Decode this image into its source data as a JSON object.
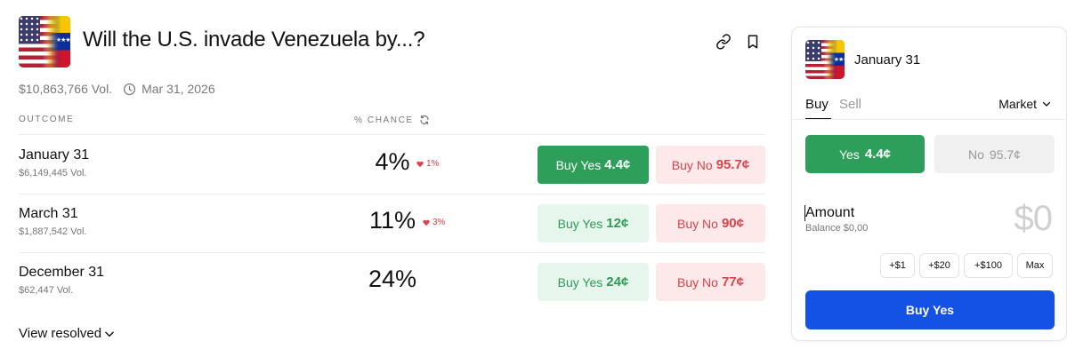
{
  "market": {
    "title": "Will the U.S. invade Venezuela by...?",
    "volume": "$10,863,766 Vol.",
    "end_date": "Mar 31, 2026"
  },
  "columns": {
    "outcome": "OUTCOME",
    "chance": "% CHANCE"
  },
  "rows": [
    {
      "name": "January 31",
      "volume": "$6,149,445 Vol.",
      "chance": "4%",
      "delta": "1%",
      "yes_label": "Buy Yes",
      "yes_price": "4.4¢",
      "no_label": "Buy No",
      "no_price": "95.7¢"
    },
    {
      "name": "March 31",
      "volume": "$1,887,542 Vol.",
      "chance": "11%",
      "delta": "3%",
      "yes_label": "Buy Yes",
      "yes_price": "12¢",
      "no_label": "Buy No",
      "no_price": "90¢"
    },
    {
      "name": "December 31",
      "volume": "$62,447 Vol.",
      "chance": "24%",
      "delta": "",
      "yes_label": "Buy Yes",
      "yes_price": "24¢",
      "no_label": "Buy No",
      "no_price": "77¢"
    }
  ],
  "view_resolved": "View resolved",
  "panel": {
    "title": "January 31",
    "tab_buy": "Buy",
    "tab_sell": "Sell",
    "order_type": "Market",
    "yes_label": "Yes",
    "yes_price": "4.4¢",
    "no_label": "No",
    "no_price": "95.7¢",
    "amount_label": "Amount",
    "balance": "Balance $0,00",
    "amount_value": "$0",
    "quick": [
      "+$1",
      "+$20",
      "+$100",
      "Max"
    ],
    "submit": "Buy Yes"
  },
  "colors": {
    "yes": "#2e9f5a",
    "no": "#d6454d",
    "primary": "#1452e5"
  },
  "icons": [
    "link-icon",
    "bookmark-icon",
    "clock-icon",
    "refresh-icon",
    "heart-down-icon",
    "chevron-down-icon"
  ]
}
